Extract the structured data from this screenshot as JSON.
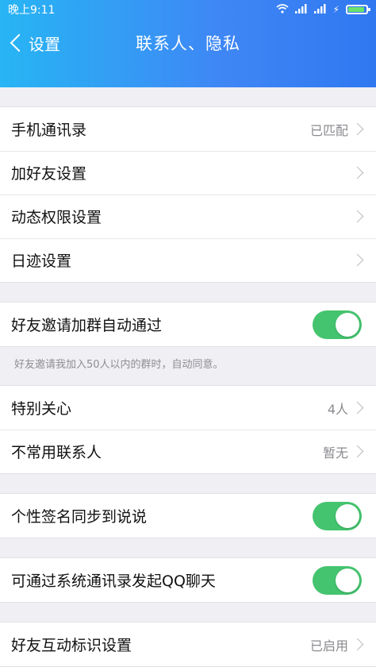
{
  "status": {
    "time": "晚上9:11"
  },
  "nav": {
    "back_label": "设置",
    "title": "联系人、隐私"
  },
  "group1": {
    "phone_contacts": {
      "label": "手机通讯录",
      "value": "已匹配"
    },
    "add_friend": {
      "label": "加好友设置"
    },
    "feed_permission": {
      "label": "动态权限设置"
    },
    "footprint": {
      "label": "日迹设置"
    }
  },
  "group2": {
    "auto_join": {
      "label": "好友邀请加群自动通过",
      "on": true
    },
    "hint": "好友邀请我加入50人以内的群时，自动同意。"
  },
  "group3": {
    "special_care": {
      "label": "特别关心",
      "value": "4人"
    },
    "rare_contacts": {
      "label": "不常用联系人",
      "value": "暂无"
    }
  },
  "group4": {
    "signature_sync": {
      "label": "个性签名同步到说说",
      "on": true
    }
  },
  "group5": {
    "system_chat": {
      "label": "可通过系统通讯录发起QQ聊天",
      "on": true
    }
  },
  "group6": {
    "interaction_badge": {
      "label": "好友互动标识设置",
      "value": "已启用"
    }
  },
  "colors": {
    "toggle_on": "#44c46e",
    "header_start": "#27b5f4",
    "header_end": "#2f78f0"
  }
}
